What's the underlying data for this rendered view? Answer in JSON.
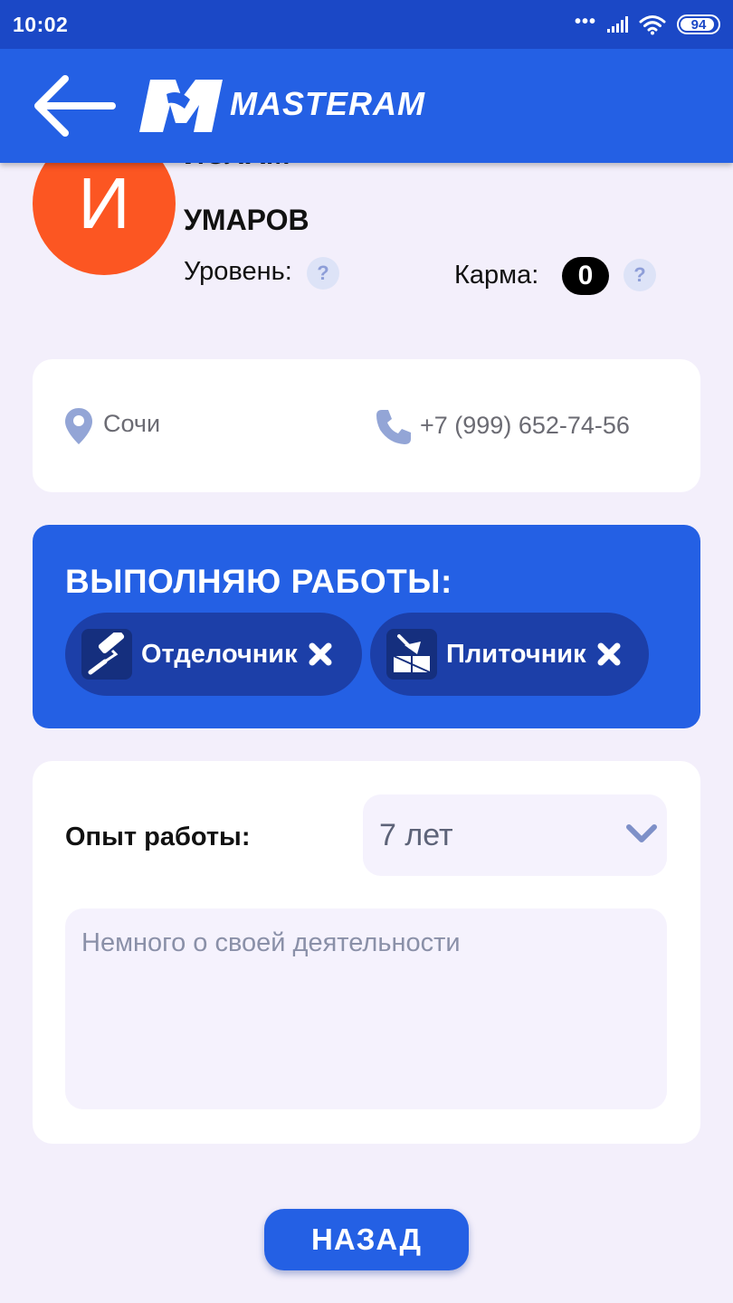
{
  "status_bar": {
    "time": "10:02",
    "dots": "•••",
    "battery": "94"
  },
  "header": {
    "logo_text": "MASTERAM",
    "logo_icon": "masteram-m-logo",
    "back_icon": "arrow-left-icon"
  },
  "profile": {
    "avatar_initial": "И",
    "first_name": "ИСЛАМ",
    "last_name": "УМАРОВ",
    "level_label": "Уровень:",
    "level_help": "?",
    "karma_label": "Карма:",
    "karma_value": "0",
    "karma_help": "?",
    "avatar_color": "#fc5622"
  },
  "contact": {
    "city": "Сочи",
    "phone": "+7 (999) 652-74-56",
    "city_icon": "location-pin-icon",
    "phone_icon": "phone-icon"
  },
  "jobs": {
    "title": "ВЫПОЛНЯЮ РАБОТЫ:",
    "items": [
      {
        "label": "Отделочник",
        "icon": "paint-roller-icon"
      },
      {
        "label": "Плиточник",
        "icon": "tile-trowel-icon"
      }
    ]
  },
  "experience": {
    "label": "Опыт работы:",
    "selected": "7 лет",
    "about_placeholder": "Немного о своей деятельности",
    "about_value": ""
  },
  "footer": {
    "back_button": "НАЗАД"
  },
  "colors": {
    "primary": "#2460e4",
    "status_bar": "#1b48c6",
    "chip": "#1c3fa8",
    "background": "#f3effb"
  }
}
